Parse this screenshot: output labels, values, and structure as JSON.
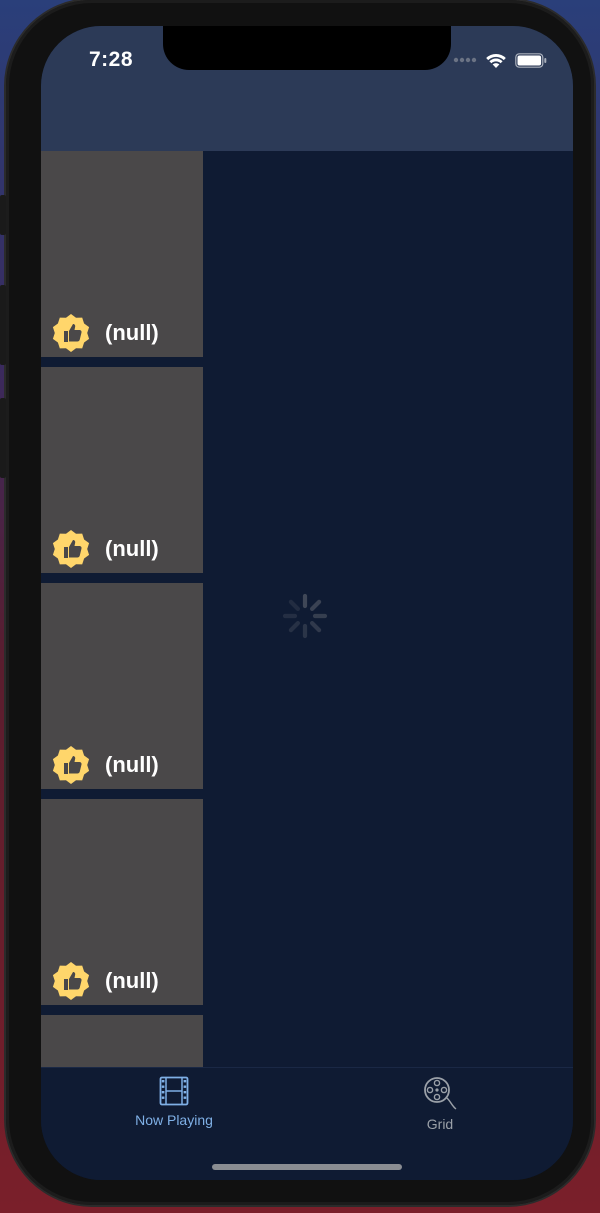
{
  "status_bar": {
    "time": "7:28",
    "icons": [
      "signal-dots-icon",
      "wifi-icon",
      "battery-icon"
    ]
  },
  "nav_bar": {
    "title": ""
  },
  "movie_list": {
    "items": [
      {
        "title": "(null)",
        "icon": "thumbs-up-badge-icon"
      },
      {
        "title": "(null)",
        "icon": "thumbs-up-badge-icon"
      },
      {
        "title": "(null)",
        "icon": "thumbs-up-badge-icon"
      },
      {
        "title": "(null)",
        "icon": "thumbs-up-badge-icon"
      },
      {
        "title": "",
        "icon": ""
      }
    ]
  },
  "loading": {
    "indicator": "spinner-icon"
  },
  "tab_bar": {
    "tabs": [
      {
        "label": "Now Playing",
        "icon": "film-strip-icon",
        "selected": true
      },
      {
        "label": "Grid",
        "icon": "film-reel-icon",
        "selected": false
      }
    ]
  },
  "colors": {
    "nav_background": "#2c3a57",
    "content_background": "#0f1b33",
    "cell_background": "#4a4849",
    "badge_yellow": "#ffd66b",
    "tab_active": "#7fb0e6",
    "tab_inactive": "#9aa0a8"
  }
}
